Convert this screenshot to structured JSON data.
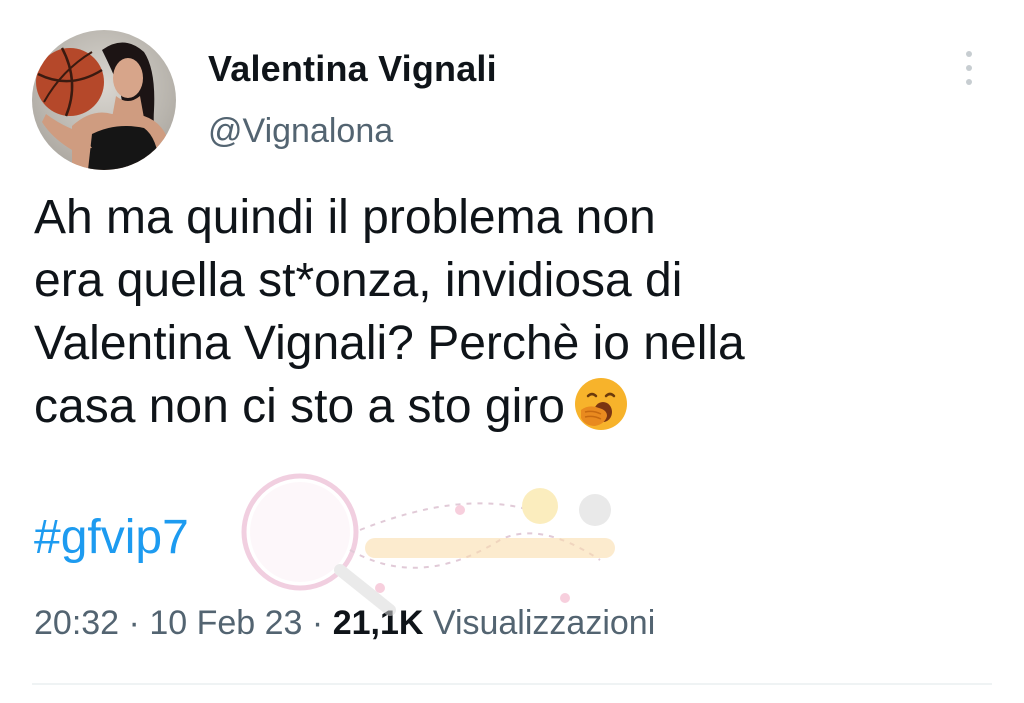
{
  "author": {
    "display_name": "Valentina Vignali",
    "handle": "@Vignalona",
    "avatar_icon": "profile-photo"
  },
  "tweet": {
    "lines": [
      "Ah ma quindi il problema non",
      "era quella st*onza, invidiosa di",
      "Valentina Vignali? Perchè io nella",
      "casa non ci sto a sto giro"
    ],
    "emoji": "yawning-face",
    "hashtag": "#gfvip7"
  },
  "meta": {
    "time": "20:32",
    "separator": "·",
    "date": "10 Feb 23",
    "views_count": "21,1K",
    "views_label": "Visualizzazioni"
  },
  "colors": {
    "text": "#0f1419",
    "secondary": "#536471",
    "link": "#1d9bf0",
    "divider": "#eff3f4"
  }
}
